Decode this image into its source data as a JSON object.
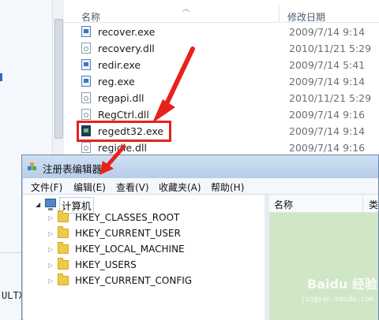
{
  "explorer": {
    "columns": {
      "name": "名称",
      "date": "修改日期"
    },
    "files": [
      {
        "name": "recover.exe",
        "date": "2009/7/14 9:14",
        "type": "exe"
      },
      {
        "name": "recovery.dll",
        "date": "2010/11/21 5:29",
        "type": "dll"
      },
      {
        "name": "redir.exe",
        "date": "2009/7/14 5:41",
        "type": "exe"
      },
      {
        "name": "reg.exe",
        "date": "2009/7/14 9:14",
        "type": "exe"
      },
      {
        "name": "regapi.dll",
        "date": "2010/11/21 5:29",
        "type": "dll"
      },
      {
        "name": "RegCtrl.dll",
        "date": "2009/7/14 9:16",
        "type": "dll"
      },
      {
        "name": "regedt32.exe",
        "date": "2009/7/14 9:14",
        "type": "exe",
        "highlighted": true
      },
      {
        "name": "regidle.dll",
        "date": "2009/7/14 9:16",
        "type": "dll"
      }
    ],
    "left_status_text": "ULTX",
    "highlight_color": "#e8211c"
  },
  "regedit": {
    "title": "注册表编辑器",
    "menu": [
      "文件(F)",
      "编辑(E)",
      "查看(V)",
      "收藏夹(A)",
      "帮助(H)"
    ],
    "tree_root": "计算机",
    "tree_items": [
      "HKEY_CLASSES_ROOT",
      "HKEY_CURRENT_USER",
      "HKEY_LOCAL_MACHINE",
      "HKEY_USERS",
      "HKEY_CURRENT_CONFIG"
    ],
    "list_columns": {
      "name": "名称",
      "type": "类"
    },
    "list_pane_color": "#cfe7c6"
  },
  "watermark": {
    "text": "Baidu 经验",
    "sub": "jingyan.baidu.com"
  }
}
